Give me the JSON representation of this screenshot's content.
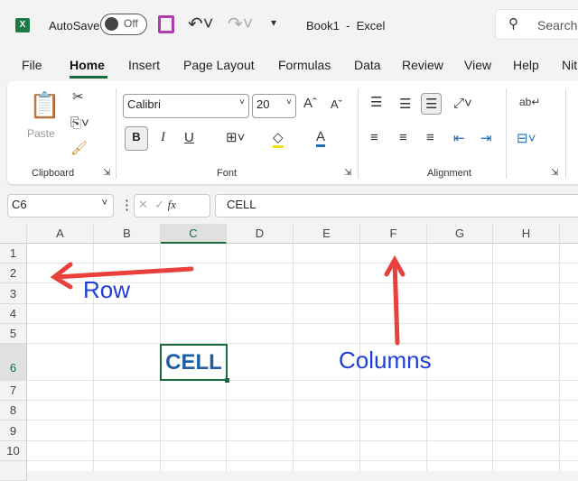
{
  "titlebar": {
    "autosave_label": "AutoSave",
    "autosave_state": "Off",
    "title": "Book1  -  Excel",
    "search_placeholder": "Search"
  },
  "tabs": [
    "File",
    "Home",
    "Insert",
    "Page Layout",
    "Formulas",
    "Data",
    "Review",
    "View",
    "Help",
    "Nit"
  ],
  "active_tab": "Home",
  "ribbon": {
    "paste_label": "Paste",
    "font_name": "Calibri",
    "font_size": "20",
    "groups": [
      "Clipboard",
      "Font",
      "Alignment"
    ],
    "bold": "B",
    "italic": "I",
    "underline": "U",
    "font_color": "A"
  },
  "formula_bar": {
    "name_box": "C6",
    "fx": "fx",
    "value": "CELL"
  },
  "grid": {
    "columns": [
      "A",
      "B",
      "C",
      "D",
      "E",
      "F",
      "G",
      "H"
    ],
    "rows": [
      "1",
      "2",
      "3",
      "4",
      "5",
      "6",
      "7",
      "8",
      "9",
      "10"
    ],
    "selected_cell": "C6",
    "cell_c6": "CELL"
  },
  "annotations": {
    "row_label": "Row",
    "columns_label": "Columns",
    "arrow_color": "#e8403a",
    "text_color": "#1f3fd8"
  }
}
